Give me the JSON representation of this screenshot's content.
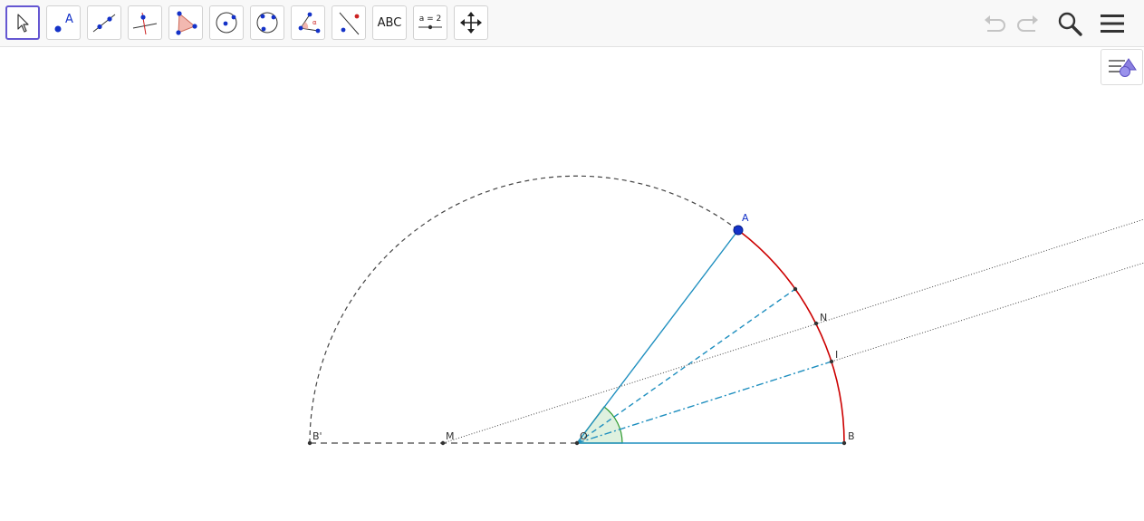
{
  "toolbar": {
    "tools": [
      {
        "name": "move-tool",
        "icon": "arrow-pointer-icon"
      },
      {
        "name": "point-tool",
        "icon": "point-icon",
        "label": "A"
      },
      {
        "name": "line-tool",
        "icon": "line-through-two-points-icon"
      },
      {
        "name": "perpendicular-line-tool",
        "icon": "perpendicular-line-icon"
      },
      {
        "name": "polygon-tool",
        "icon": "polygon-icon"
      },
      {
        "name": "circle-tool",
        "icon": "circle-with-center-icon"
      },
      {
        "name": "circle-three-points-tool",
        "icon": "circle-through-three-points-icon"
      },
      {
        "name": "angle-tool",
        "icon": "angle-icon"
      },
      {
        "name": "reflect-tool",
        "icon": "reflect-about-line-icon"
      },
      {
        "name": "text-tool",
        "label": "ABC"
      },
      {
        "name": "slider-tool",
        "label": "a = 2"
      },
      {
        "name": "move-graphics-view-tool",
        "icon": "move-arrows-icon"
      }
    ],
    "selected_tool": "move-tool",
    "undo_icon": "undo-icon",
    "redo_icon": "redo-icon",
    "search_icon": "search-icon",
    "menu_icon": "hamburger-menu-icon",
    "accent_color": "#6557d2"
  },
  "style_bar_toggle_icon": "style-bar-toggle-icon",
  "construction": {
    "labels": {
      "A": "A",
      "B": "B",
      "B_prime": "B'",
      "O": "O",
      "M": "M",
      "N": "N",
      "I": "I"
    },
    "colors": {
      "segment": "#1f8fbf",
      "arc": "#cc0000",
      "angle_fill": "#dff1df",
      "angle_stroke": "#2e9a2e",
      "point_A": "#1432c8",
      "dashed": "#444444"
    }
  }
}
